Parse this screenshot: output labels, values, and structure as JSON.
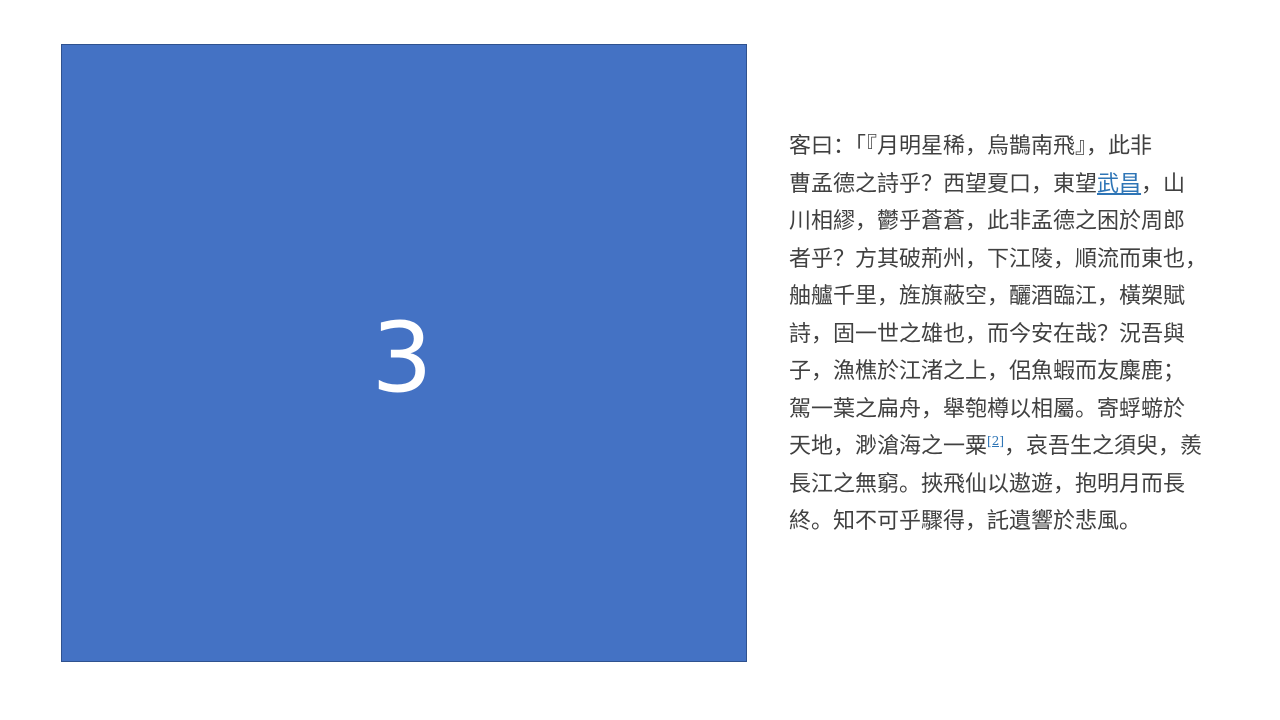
{
  "slide": {
    "box_number": "3",
    "box_color": "#4472c4",
    "text_color": "#404040",
    "link_color": "#2e75b6"
  },
  "passage": {
    "lines": [
      {
        "pre": "客曰：「『月明星稀，烏鵲南飛』，此非"
      },
      {
        "pre": "曹孟德之詩乎？西望夏口，東望",
        "link": "武昌",
        "post": "，山"
      },
      {
        "pre": "川相繆，鬱乎蒼蒼，此非孟德之困於周郎"
      },
      {
        "pre": "者乎？方其破荊州，下江陵，順流而東也，"
      },
      {
        "pre": "舳艫千里，旌旗蔽空，釃酒臨江，橫槊賦"
      },
      {
        "pre": "詩，固一世之雄也，而今安在哉？況吾與"
      },
      {
        "pre": "子，漁樵於江渚之上，侶魚蝦而友麋鹿；"
      },
      {
        "pre": "駕一葉之扁舟，舉匏樽以相屬。寄蜉蝣於"
      },
      {
        "pre": "天地，渺滄海之一粟",
        "sup": "[2]",
        "post": "，哀吾生之須臾，羨"
      },
      {
        "pre": "長江之無窮。挾飛仙以遨遊，抱明月而長"
      },
      {
        "pre": "終。知不可乎驟得，託遺響於悲風。"
      }
    ]
  }
}
